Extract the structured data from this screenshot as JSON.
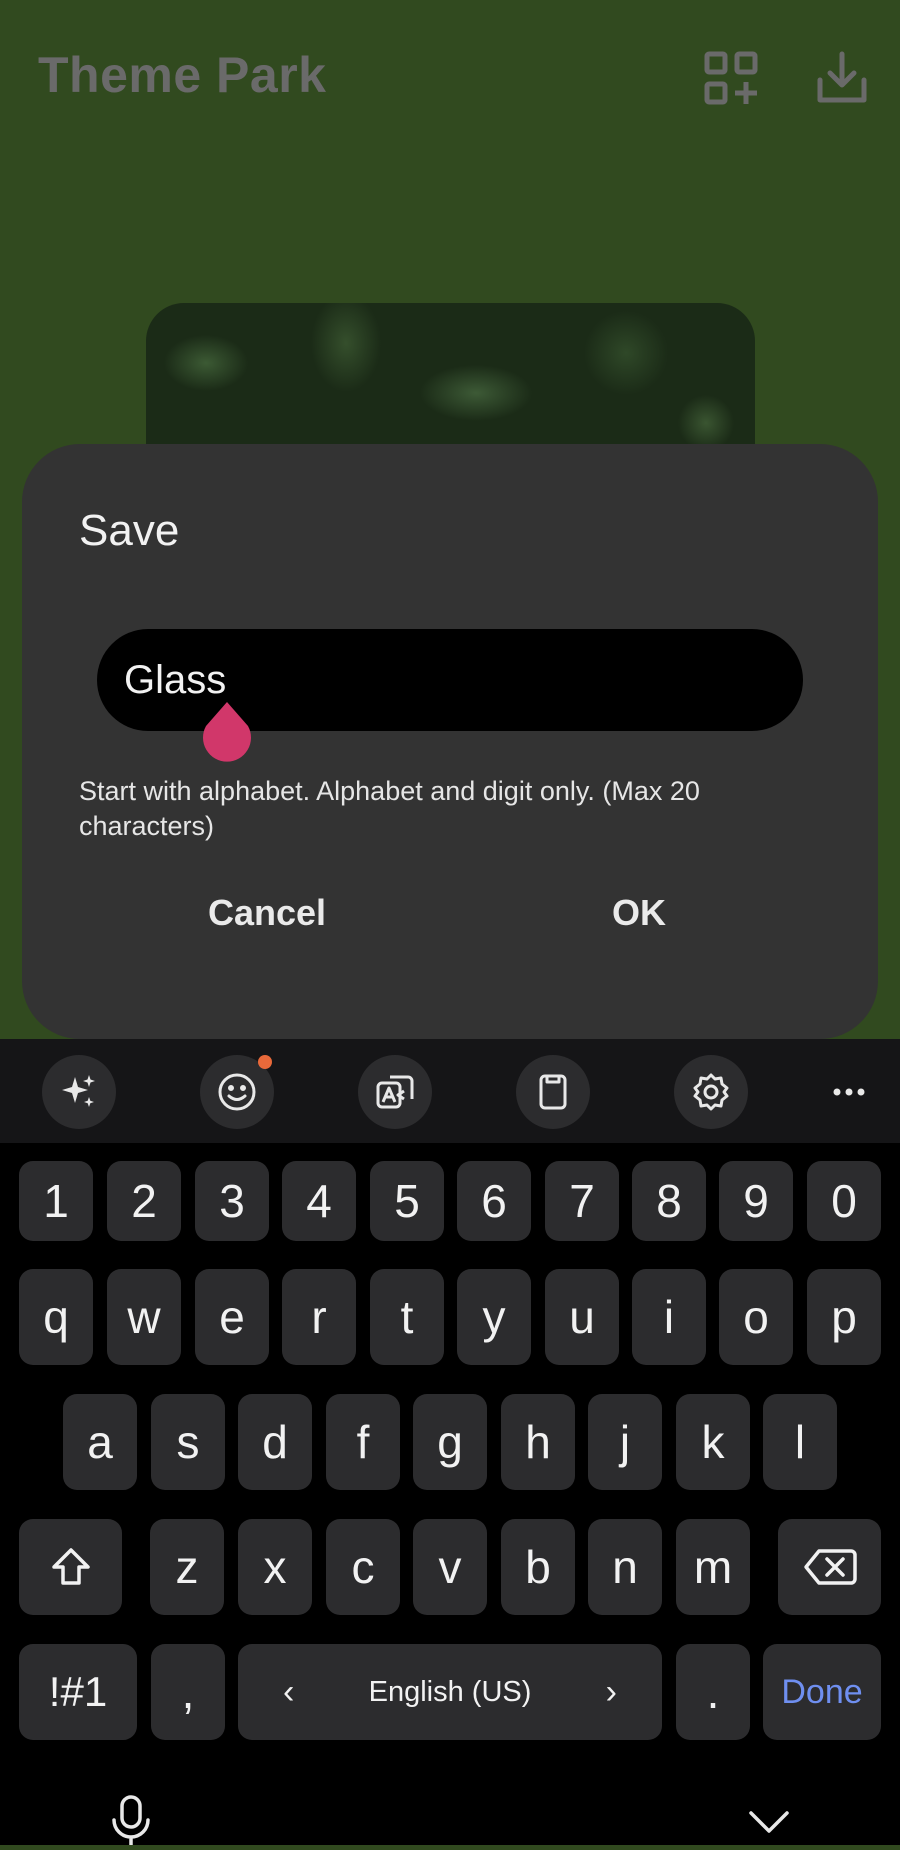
{
  "app": {
    "title": "Theme Park",
    "icons": [
      "qr-add-icon",
      "download-icon"
    ]
  },
  "dialog": {
    "title": "Save",
    "input_value": "Glass",
    "hint": "Start with alphabet. Alphabet and digit only. (Max 20 characters)",
    "cancel_label": "Cancel",
    "ok_label": "OK"
  },
  "keyboard": {
    "toolbar_icons": [
      "sparkle-icon",
      "emoji-icon",
      "translate-icon",
      "clipboard-icon",
      "settings-icon",
      "more-icon"
    ],
    "emoji_badge_color": "#e8693a",
    "row_numbers": [
      "1",
      "2",
      "3",
      "4",
      "5",
      "6",
      "7",
      "8",
      "9",
      "0"
    ],
    "row1": [
      "q",
      "w",
      "e",
      "r",
      "t",
      "y",
      "u",
      "i",
      "o",
      "p"
    ],
    "row2": [
      "a",
      "s",
      "d",
      "f",
      "g",
      "h",
      "j",
      "k",
      "l"
    ],
    "row3": [
      "z",
      "x",
      "c",
      "v",
      "b",
      "n",
      "m"
    ],
    "symbols_label": "!#1",
    "comma_label": ",",
    "space_label": "English (US)",
    "space_left": "‹",
    "space_right": "›",
    "period_label": ".",
    "done_label": "Done",
    "accent_color": "#6f8ff0",
    "bottom_icons": [
      "microphone-icon",
      "hide-keyboard-icon"
    ]
  },
  "colors": {
    "app_background": "#314a1f",
    "dialog": "#333333",
    "cursor_handle": "#d1376a"
  }
}
